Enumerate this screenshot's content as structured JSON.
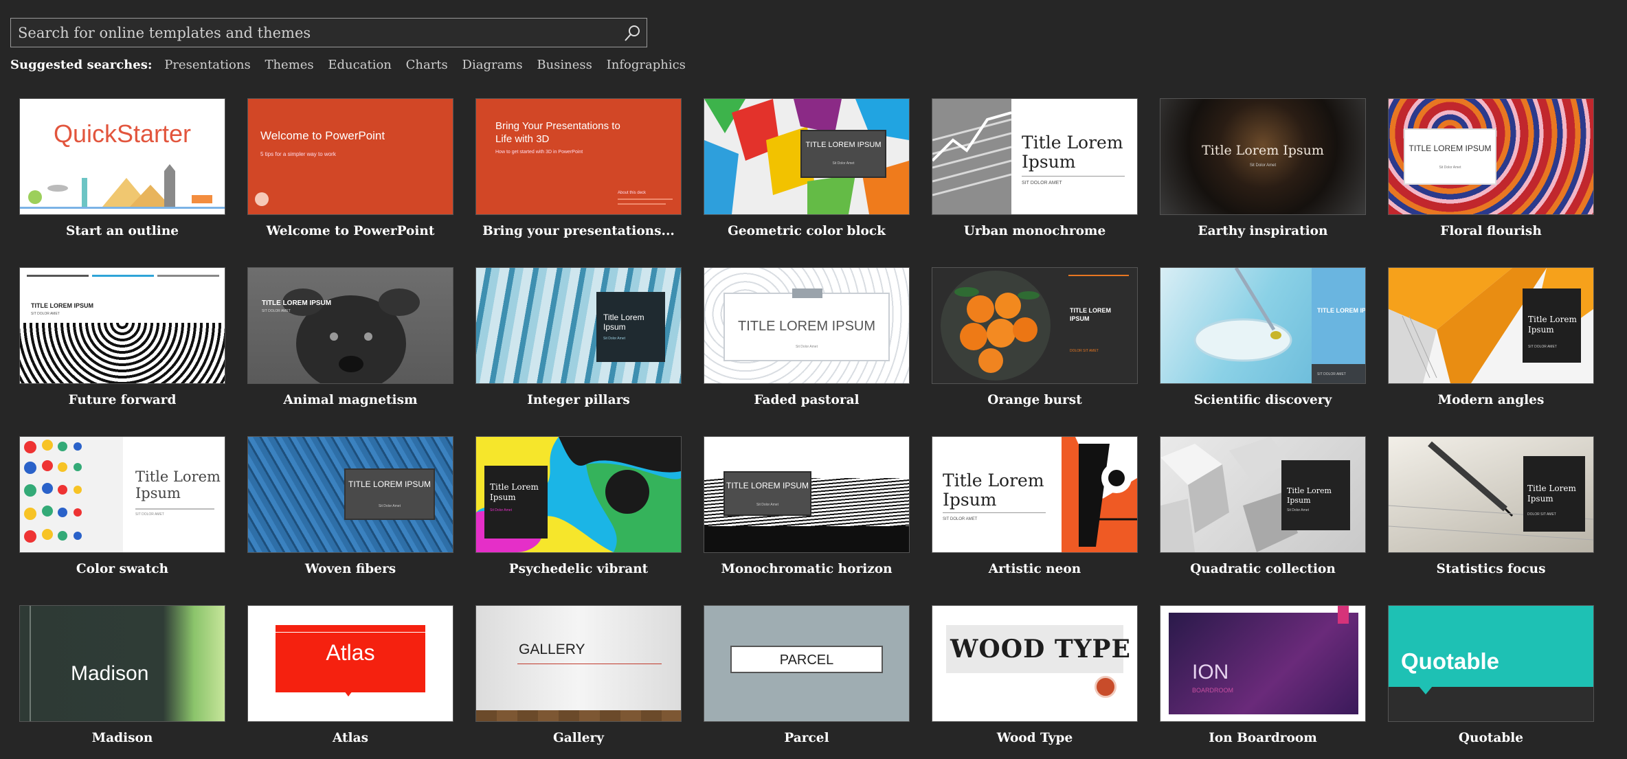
{
  "search": {
    "placeholder": "Search for online templates and themes",
    "icon": "search-icon"
  },
  "suggested": {
    "label": "Suggested searches:",
    "items": [
      "Presentations",
      "Themes",
      "Education",
      "Charts",
      "Diagrams",
      "Business",
      "Infographics"
    ]
  },
  "templates": [
    {
      "name": "Start an outline",
      "thumb_text": "QuickStarter"
    },
    {
      "name": "Welcome to PowerPoint",
      "thumb_text": "Welcome to PowerPoint",
      "thumb_sub": "5 tips for a simpler way to work"
    },
    {
      "name": "Bring your presentations...",
      "thumb_text": "Bring Your Presentations to Life with 3D",
      "thumb_sub": "How to get started with 3D in PowerPoint",
      "thumb_note": "About this deck"
    },
    {
      "name": "Geometric color block",
      "thumb_text": "TITLE LOREM IPSUM",
      "thumb_sub": "Sit Dolor Amet"
    },
    {
      "name": "Urban monochrome",
      "thumb_text": "Title Lorem Ipsum",
      "thumb_sub": "SIT DOLOR AMET"
    },
    {
      "name": "Earthy inspiration",
      "thumb_text": "Title Lorem Ipsum",
      "thumb_sub": "Sit Dolor Amet"
    },
    {
      "name": "Floral flourish",
      "thumb_text": "TITLE LOREM IPSUM",
      "thumb_sub": "Sit Dolor Amet"
    },
    {
      "name": "Future forward",
      "thumb_text": "TITLE LOREM IPSUM",
      "thumb_sub": "SIT DOLOR AMET"
    },
    {
      "name": "Animal magnetism",
      "thumb_text": "TITLE LOREM IPSUM",
      "thumb_sub": "SIT DOLOR AMET"
    },
    {
      "name": "Integer pillars",
      "thumb_text": "Title Lorem Ipsum",
      "thumb_sub": "Sit Dolor Amet"
    },
    {
      "name": "Faded pastoral",
      "thumb_text": "TITLE LOREM IPSUM",
      "thumb_sub": "Sit Dolor Amet"
    },
    {
      "name": "Orange burst",
      "thumb_text": "TITLE LOREM IPSUM",
      "thumb_sub": "DOLOR SIT AMET"
    },
    {
      "name": "Scientific discovery",
      "thumb_text": "TITLE LOREM IPSUM",
      "thumb_sub": "SIT DOLOR AMET"
    },
    {
      "name": "Modern angles",
      "thumb_text": "Title Lorem Ipsum",
      "thumb_sub": "SIT DOLOR AMET"
    },
    {
      "name": "Color swatch",
      "thumb_text": "Title Lorem Ipsum",
      "thumb_sub": "SIT DOLOR AMET"
    },
    {
      "name": "Woven fibers",
      "thumb_text": "TITLE LOREM IPSUM",
      "thumb_sub": "Sit Dolor Amet"
    },
    {
      "name": "Psychedelic vibrant",
      "thumb_text": "Title Lorem Ipsum",
      "thumb_sub": "Sit Dolor Amet"
    },
    {
      "name": "Monochromatic horizon",
      "thumb_text": "TITLE LOREM IPSUM",
      "thumb_sub": "Sit Dolor Amet"
    },
    {
      "name": "Artistic neon",
      "thumb_text": "Title Lorem Ipsum",
      "thumb_sub": "SIT DOLOR AMET"
    },
    {
      "name": "Quadratic collection",
      "thumb_text": "Title Lorem Ipsum",
      "thumb_sub": "Sit Dolor Amet"
    },
    {
      "name": "Statistics focus",
      "thumb_text": "Title Lorem Ipsum",
      "thumb_sub": "DOLOR SIT AMET"
    },
    {
      "name": "Madison",
      "thumb_text": "Madison"
    },
    {
      "name": "Atlas",
      "thumb_text": "Atlas"
    },
    {
      "name": "Gallery",
      "thumb_text": "GALLERY"
    },
    {
      "name": "Parcel",
      "thumb_text": "PARCEL"
    },
    {
      "name": "Wood Type",
      "thumb_text": "WOOD TYPE"
    },
    {
      "name": "Ion Boardroom",
      "thumb_text": "ION",
      "thumb_sub": "BOARDROOM"
    },
    {
      "name": "Quotable",
      "thumb_text": "Quotable"
    }
  ],
  "colors": {
    "background": "#262626",
    "powerpoint_orange": "#d24726",
    "quotable_teal": "#1ec1b4",
    "atlas_red": "#f5210f"
  }
}
